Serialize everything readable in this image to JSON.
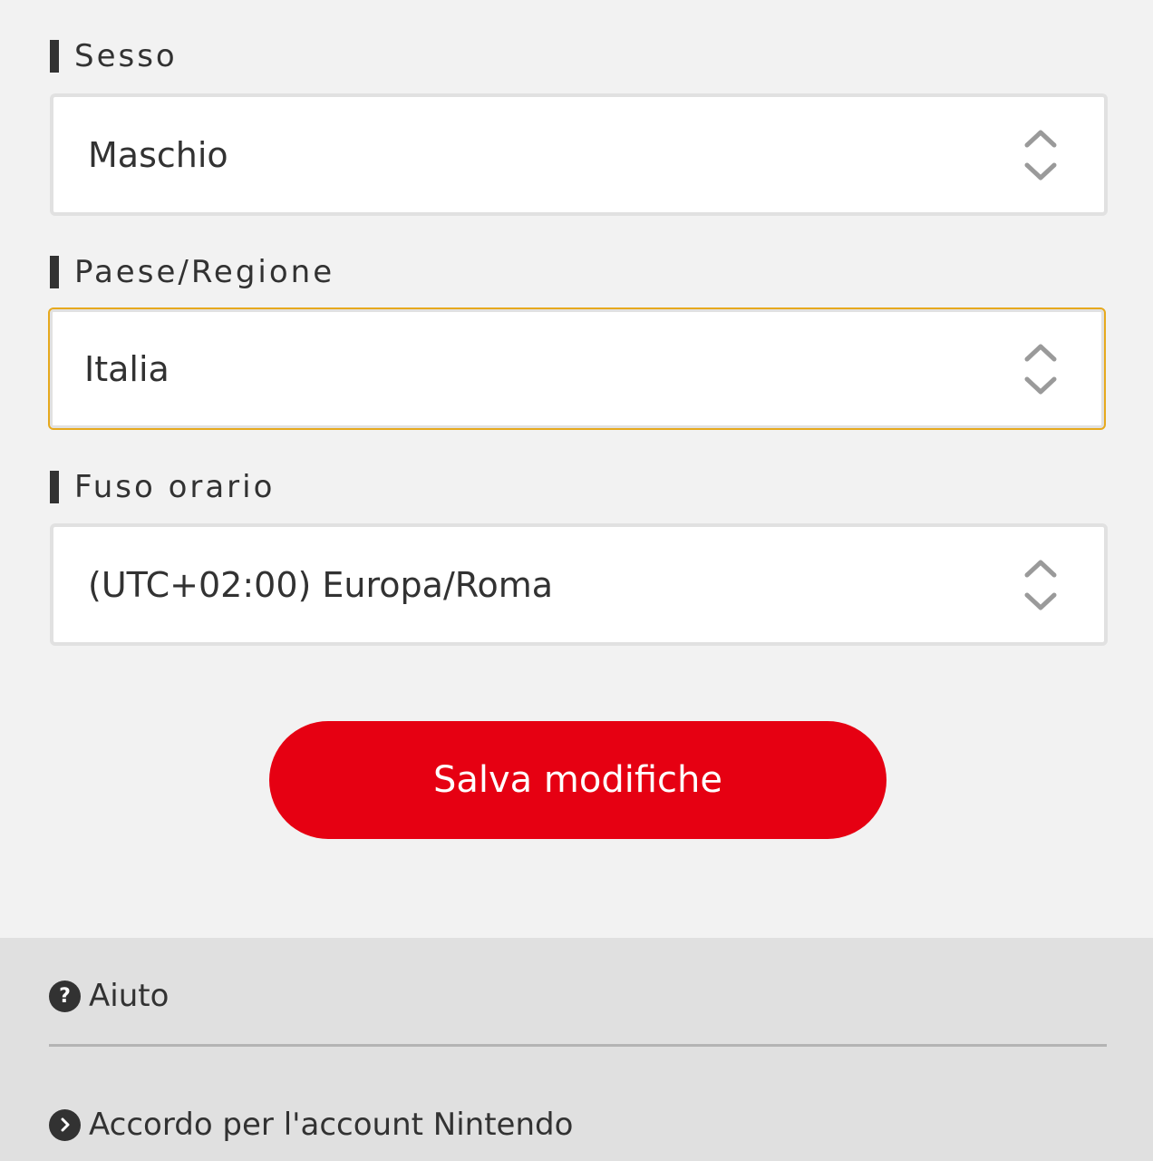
{
  "form": {
    "gender": {
      "label": "Sesso",
      "value": "Maschio"
    },
    "country": {
      "label": "Paese/Regione",
      "value": "Italia",
      "focused": true
    },
    "timezone": {
      "label": "Fuso orario",
      "value": "(UTC+02:00) Europa/Roma"
    },
    "save_label": "Salva modifiche"
  },
  "footer": {
    "help_label": "Aiuto",
    "help_icon": "question-circle-icon",
    "agreement_label": "Accordo per l'account Nintendo",
    "agreement_icon": "chevron-right-circle-icon"
  },
  "colors": {
    "accent_red": "#e60012",
    "focus_border": "#e6a91e",
    "text": "#323232",
    "background": "#f2f2f2",
    "footer_background": "#e0e0e0"
  }
}
